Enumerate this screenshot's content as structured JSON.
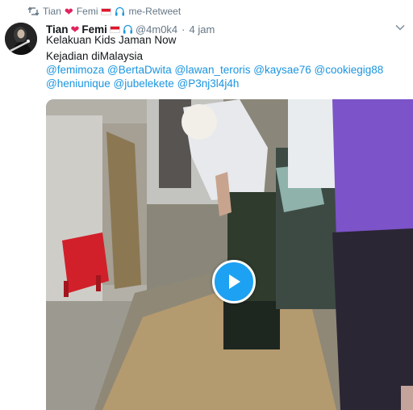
{
  "retweet": {
    "icon": "retweet-icon",
    "name_first": "Tian",
    "name_second": "Femi",
    "suffix": "me-Retweet"
  },
  "tweet": {
    "display_name_first": "Tian",
    "display_name_second": "Femi",
    "handle": "@4m0k4",
    "separator": "·",
    "time": "4 jam",
    "text_line1": "Kelakuan Kids Jaman Now",
    "text_line2": "Kejadian diMalaysia",
    "mentions_line1": [
      "@femimoza",
      "@BertaDwita",
      "@lawan_teroris",
      "@kaysae76",
      "@cookiegig88"
    ],
    "mentions_line2": [
      "@heniunique",
      "@jubelekete",
      "@P3nj3l4j4h"
    ]
  },
  "media": {
    "type": "video",
    "play_icon": "play-icon"
  },
  "colors": {
    "link": "#1b95e0",
    "secondary_text": "#657786",
    "play_button": "#1da1f2",
    "heart": "#e0245e"
  }
}
